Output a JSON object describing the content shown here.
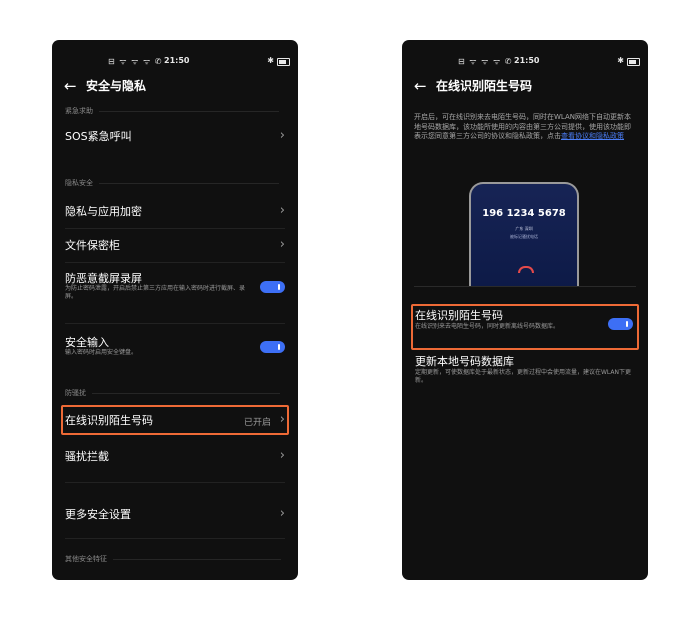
{
  "left": {
    "status": {
      "icons": "⊟ ᯤ ᯤ ᯤ ✆",
      "time": "21:50",
      "bt": "✱"
    },
    "header": {
      "title": "安全与隐私"
    },
    "sections": {
      "emergency": "紧急求助",
      "privacy": "隐私安全",
      "harass": "防骚扰",
      "other": "其他安全特征"
    },
    "items": {
      "sos": {
        "title": "SOS紧急呼叫"
      },
      "app_encrypt": {
        "title": "隐私与应用加密"
      },
      "file_safe": {
        "title": "文件保密柜"
      },
      "anti_peek": {
        "title": "防恶意截屏录屏",
        "subtitle": "为防止密码泄露，开启后禁止第三方应用在输入密码时进行截屏、录屏。",
        "on": true
      },
      "secure_input": {
        "title": "安全输入",
        "subtitle": "输入密码时启用安全键盘。",
        "on": true
      },
      "stranger_id": {
        "title": "在线识别陌生号码",
        "value": "已开启"
      },
      "harass_block": {
        "title": "骚扰拦截"
      },
      "more_security": {
        "title": "更多安全设置"
      }
    }
  },
  "right": {
    "status": {
      "icons": "⊟ ᯤ ᯤ ᯤ ✆",
      "time": "21:50",
      "bt": "✱"
    },
    "header": {
      "title": "在线识别陌生号码"
    },
    "intro": {
      "text": "开启后，可在线识别来去电陌生号码，同时在WLAN网络下自动更新本地号码数据库，该功能所使用的内容由第三方公司提供，使用该功能即表示您同意第三方公司的协议和隐私政策，点击",
      "link": "查看协议和隐私政策"
    },
    "mockup": {
      "number": "196 1234 5678",
      "location": "广东 深圳",
      "mark": "被标记骚扰电话"
    },
    "items": {
      "online_id": {
        "title": "在线识别陌生号码",
        "subtitle": "在线识别来去电陌生号码，同时更新离线号码数据库。",
        "on": true
      },
      "update_db": {
        "title": "更新本地号码数据库",
        "subtitle": "定期更新，可使数据库处于最新状态，更新过程中会使用流量，建议在WLAN下更新。"
      }
    }
  },
  "colors": {
    "accent": "#3d6ff5",
    "highlight": "#ee6a36",
    "background": "#101010"
  }
}
